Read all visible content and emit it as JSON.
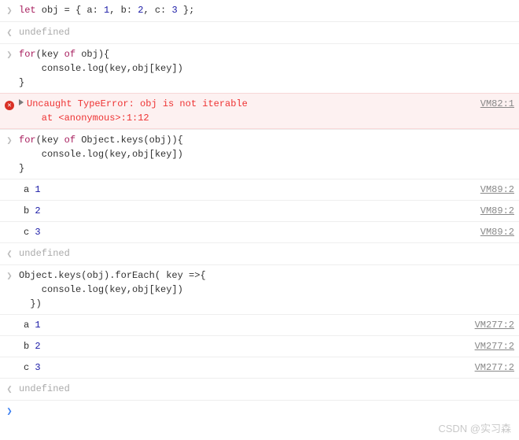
{
  "entries": [
    {
      "kind": "input",
      "code": "let obj = { a: 1, b: 2, c: 3 };"
    },
    {
      "kind": "result",
      "text": "undefined"
    },
    {
      "kind": "input",
      "code": "for(key of obj){\n    console.log(key,obj[key])\n}"
    },
    {
      "kind": "error",
      "text": "Uncaught TypeError: obj is not iterable\n    at <anonymous>:1:12",
      "source": "VM82:1"
    },
    {
      "kind": "input",
      "code": "for(key of Object.keys(obj)){\n    console.log(key,obj[key])\n}"
    },
    {
      "kind": "log",
      "text": "a 1",
      "source": "VM89:2"
    },
    {
      "kind": "log",
      "text": "b 2",
      "source": "VM89:2"
    },
    {
      "kind": "log",
      "text": "c 3",
      "source": "VM89:2"
    },
    {
      "kind": "result",
      "text": "undefined"
    },
    {
      "kind": "input",
      "code": "Object.keys(obj).forEach( key =>{\n    console.log(key,obj[key])\n  })"
    },
    {
      "kind": "log",
      "text": "a 1",
      "source": "VM277:2"
    },
    {
      "kind": "log",
      "text": "b 2",
      "source": "VM277:2"
    },
    {
      "kind": "log",
      "text": "c 3",
      "source": "VM277:2"
    },
    {
      "kind": "result",
      "text": "undefined"
    },
    {
      "kind": "prompt",
      "text": ""
    }
  ],
  "gutter": {
    "input": "❯",
    "result": "❮",
    "prompt": "❯"
  },
  "watermark": "CSDN @实习森"
}
